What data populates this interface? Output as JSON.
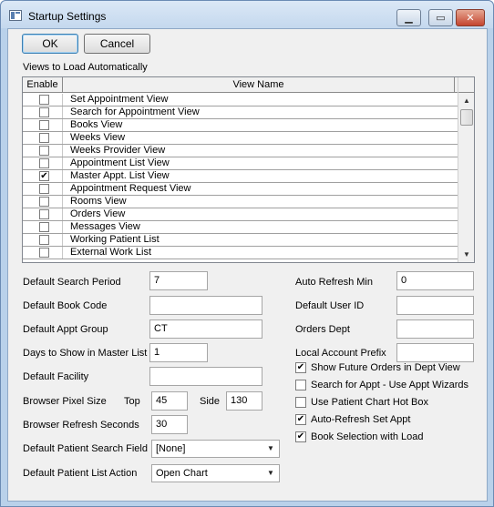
{
  "window": {
    "title": "Startup Settings"
  },
  "buttons": {
    "ok": "OK",
    "cancel": "Cancel"
  },
  "views": {
    "label": "Views to Load Automatically",
    "columns": {
      "enable": "Enable",
      "view_name": "View Name"
    },
    "rows": [
      {
        "name": "Set Appointment View",
        "enabled": false
      },
      {
        "name": "Search for Appointment View",
        "enabled": false
      },
      {
        "name": "Books View",
        "enabled": false
      },
      {
        "name": "Weeks View",
        "enabled": false
      },
      {
        "name": "Weeks Provider View",
        "enabled": false
      },
      {
        "name": "Appointment List View",
        "enabled": false
      },
      {
        "name": "Master Appt. List View",
        "enabled": true
      },
      {
        "name": "Appointment Request View",
        "enabled": false
      },
      {
        "name": "Rooms View",
        "enabled": false
      },
      {
        "name": "Orders View",
        "enabled": false
      },
      {
        "name": "Messages View",
        "enabled": false
      },
      {
        "name": "Working Patient List",
        "enabled": false
      },
      {
        "name": "External Work List",
        "enabled": false
      }
    ]
  },
  "fields": {
    "default_search_period": {
      "label": "Default Search Period",
      "value": "7"
    },
    "default_book_code": {
      "label": "Default Book Code",
      "value": ""
    },
    "default_appt_group": {
      "label": "Default Appt Group",
      "value": "CT"
    },
    "days_master_list": {
      "label": "Days to Show in Master List",
      "value": "1"
    },
    "default_facility": {
      "label": "Default Facility",
      "value": ""
    },
    "browser_pixel_size": {
      "label": "Browser Pixel Size",
      "top_label": "Top",
      "top_value": "45",
      "side_label": "Side",
      "side_value": "130"
    },
    "browser_refresh_seconds": {
      "label": "Browser Refresh Seconds",
      "value": "30"
    },
    "default_patient_search_field": {
      "label": "Default Patient Search Field",
      "value": "[None]"
    },
    "default_patient_list_action": {
      "label": "Default Patient List Action",
      "value": "Open Chart"
    },
    "auto_refresh_min": {
      "label": "Auto Refresh Min",
      "value": "0"
    },
    "default_user_id": {
      "label": "Default User ID",
      "value": ""
    },
    "orders_dept": {
      "label": "Orders Dept",
      "value": ""
    },
    "local_account_prefix": {
      "label": "Local Account Prefix",
      "value": ""
    }
  },
  "options": [
    {
      "label": "Show Future Orders in Dept View",
      "checked": true
    },
    {
      "label": "Search for Appt - Use Appt Wizards",
      "checked": false
    },
    {
      "label": "Use Patient Chart Hot Box",
      "checked": false
    },
    {
      "label": "Auto-Refresh Set Appt",
      "checked": true
    },
    {
      "label": "Book Selection with Load",
      "checked": true
    }
  ]
}
